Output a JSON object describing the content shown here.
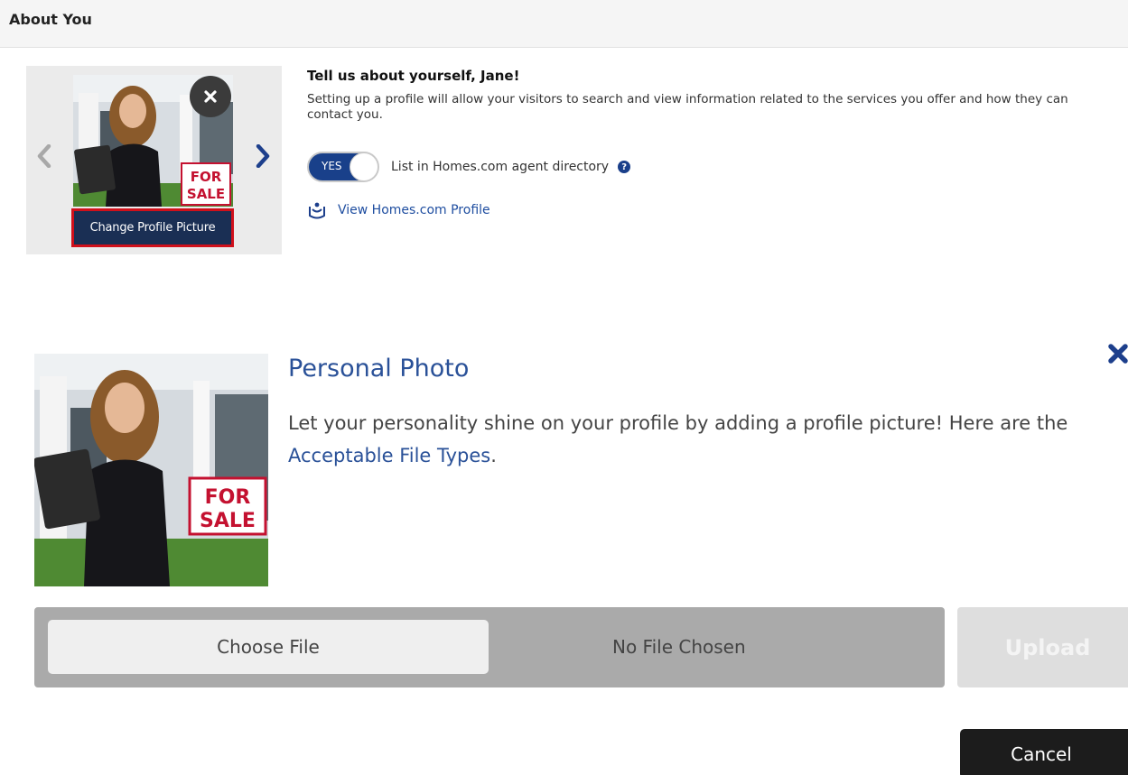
{
  "header": {
    "title": "About You"
  },
  "profile": {
    "heading": "Tell us about yourself, Jane!",
    "description": "Setting up a profile will allow your visitors to search and view information related to the services you offer and how they can contact you.",
    "toggle_state": "YES",
    "toggle_label": "List in Homes.com agent directory",
    "help_glyph": "?",
    "view_profile_link": "View Homes.com Profile",
    "change_picture_button": "Change Profile Picture"
  },
  "photo_sign": {
    "line1": "FOR",
    "line2": "SALE"
  },
  "personal_photo": {
    "title": "Personal Photo",
    "description_before": "Let your personality shine on your profile by adding a profile picture! Here are the ",
    "link_text": "Acceptable File Types",
    "description_after": ".",
    "choose_file_label": "Choose File",
    "file_status": "No File Chosen",
    "upload_label": "Upload",
    "cancel_label": "Cancel"
  },
  "colors": {
    "accent_blue": "#19408a",
    "link_blue": "#2a5198",
    "highlight_red": "#d0101b",
    "dark_button": "#1c1c1c"
  },
  "icons": {
    "prev": "chevron-left-icon",
    "next": "chevron-right-icon",
    "remove": "close-icon",
    "help": "question-circle-icon",
    "profile": "profile-badge-icon",
    "panel_close": "close-x-icon"
  }
}
